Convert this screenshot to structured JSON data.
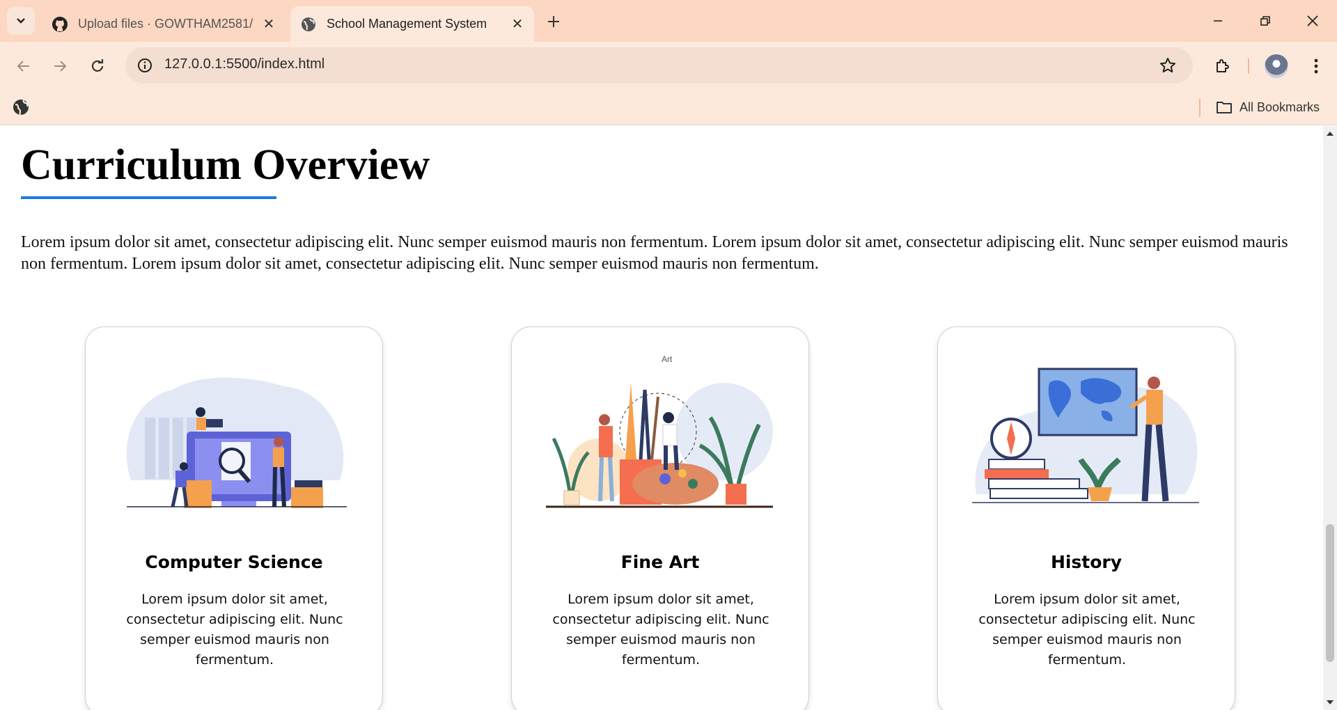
{
  "browser": {
    "tabs": [
      {
        "title": "Upload files · GOWTHAM2581/",
        "icon": "github-icon",
        "active": false
      },
      {
        "title": "School Management System",
        "icon": "globe-icon",
        "active": true
      }
    ],
    "address": "127.0.0.1:5500/index.html",
    "bookmarks_label": "All Bookmarks",
    "accent_color": "#fcd7c1"
  },
  "page": {
    "heading": "Curriculum Overview",
    "underline_color": "#1f7ae0",
    "intro": "Lorem ipsum dolor sit amet, consectetur adipiscing elit. Nunc semper euismod mauris non fermentum. Lorem ipsum dolor sit amet, consectetur adipiscing elit. Nunc semper euismod mauris non fermentum. Lorem ipsum dolor sit amet, consectetur adipiscing elit. Nunc semper euismod mauris non fermentum.",
    "cards": [
      {
        "title": "Computer Science",
        "text": "Lorem ipsum dolor sit amet, consectetur adipiscing elit. Nunc semper euismod mauris non fermentum.",
        "illustration": "computer-science-illustration"
      },
      {
        "title": "Fine Art",
        "text": "Lorem ipsum dolor sit amet, consectetur adipiscing elit. Nunc semper euismod mauris non fermentum.",
        "illustration": "fine-art-illustration",
        "illustration_label": "Art"
      },
      {
        "title": "History",
        "text": "Lorem ipsum dolor sit amet, consectetur adipiscing elit. Nunc semper euismod mauris non fermentum.",
        "illustration": "history-illustration"
      }
    ]
  }
}
